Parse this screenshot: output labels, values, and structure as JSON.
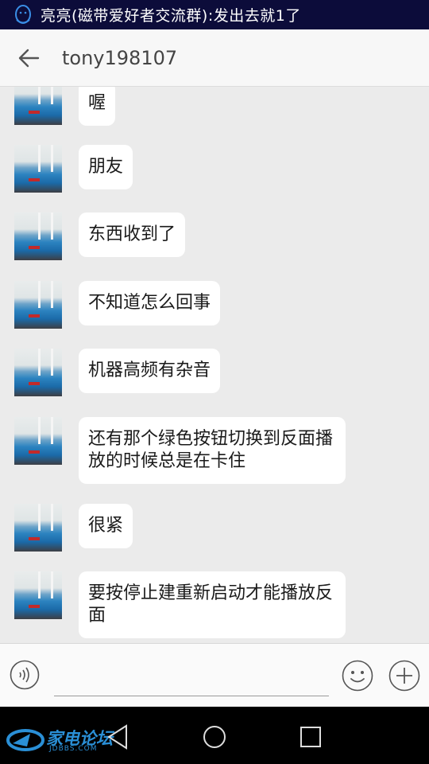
{
  "status_bar": {
    "notification_text": "亮亮(磁带爱好者交流群):发出去就1了",
    "notification_icon": "qq-penguin-icon"
  },
  "header": {
    "back_icon": "arrow-left-icon",
    "title": "tony198107"
  },
  "messages": [
    {
      "text": "喔"
    },
    {
      "text": "朋友"
    },
    {
      "text": "东西收到了"
    },
    {
      "text": "不知道怎么回事"
    },
    {
      "text": "机器高频有杂音"
    },
    {
      "text": "还有那个绿色按钮切换到反面播放的时候总是在卡住"
    },
    {
      "text": "很紧"
    },
    {
      "text": "要按停止建重新启动才能播放反面"
    }
  ],
  "input_bar": {
    "voice_icon": "voice-wave-icon",
    "placeholder": "",
    "value": "",
    "emoji_icon": "smiley-icon",
    "more_icon": "plus-circle-icon"
  },
  "nav_bar": {
    "back_icon": "triangle-back-icon",
    "home_icon": "circle-home-icon",
    "recents_icon": "square-recents-icon"
  },
  "watermark": {
    "name": "家电论坛",
    "domain": "JDBBS.COM"
  },
  "colors": {
    "status_bar": "#0c0c3a",
    "chat_background": "#ebebeb",
    "bubble": "#ffffff",
    "watermark": "#2a8fd6"
  }
}
